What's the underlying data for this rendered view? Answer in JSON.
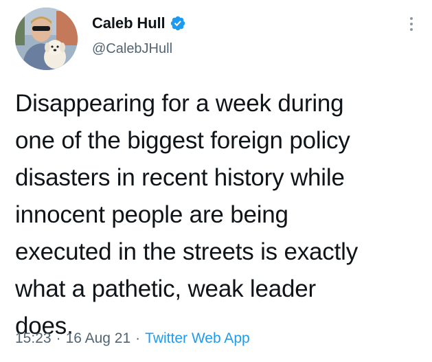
{
  "author": {
    "display_name": "Caleb Hull",
    "handle": "@CalebJHull",
    "verified_icon": "verified-badge-icon",
    "verified_color": "#1d9bf0"
  },
  "tweet": {
    "lines": [
      "Disappearing for a week during",
      "one of the biggest foreign policy",
      "disasters in recent history while",
      "innocent people are being",
      "executed in the streets is exactly",
      "what a pathetic, weak leader",
      "does."
    ]
  },
  "meta": {
    "time": "15:23",
    "separator": "·",
    "date": "16 Aug 21",
    "source": "Twitter Web App"
  },
  "icons": {
    "more": "more-options-icon",
    "avatar": "profile-photo"
  },
  "colors": {
    "text": "#0f1419",
    "secondary": "#536471",
    "accent": "#1d9bf0",
    "background": "#ffffff"
  }
}
